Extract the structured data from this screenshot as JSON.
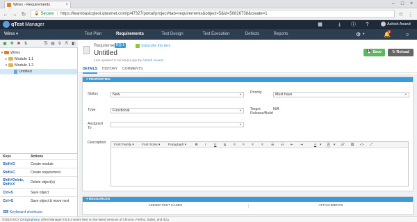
{
  "browser": {
    "tab_title": "Wires - Requirements",
    "url_secure_label": "Secure",
    "url": "https://learnbasicqtest.qtestnet.com/p/47327/portal/project#tab=requirements&object=5&id=50826738&create=1"
  },
  "app": {
    "logo_text": "qTest",
    "product": "Manager",
    "user_name": "Ashish Anand",
    "notif_count": "1",
    "colors": {
      "header": "#1e2a3a",
      "nav": "#2c3e50",
      "accent": "#3b9ad9",
      "save": "#5cb85c"
    }
  },
  "nav": {
    "project": "Wires",
    "tabs": [
      {
        "label": "Test Plan"
      },
      {
        "label": "Requirements"
      },
      {
        "label": "Test Design"
      },
      {
        "label": "Test Execution"
      },
      {
        "label": "Defects"
      },
      {
        "label": "Reports"
      }
    ],
    "active_tab": "Requirements"
  },
  "tree": {
    "root": "Wires",
    "items": [
      {
        "label": "Module 1.1"
      },
      {
        "label": "Module 1.2"
      },
      {
        "label": "Untitled"
      }
    ]
  },
  "shortcuts": {
    "head_key": "Keys",
    "head_action": "Actions",
    "rows": [
      {
        "key": "Shift+D",
        "action": "Create module"
      },
      {
        "key": "Shift+C",
        "action": "Create requirement"
      },
      {
        "key": "Shift+Delete, Shift+X",
        "action": "Delete object(s)"
      },
      {
        "key": "Ctrl+S",
        "action": "Save object"
      },
      {
        "key": "Ctrl+G",
        "action": "Save object & move next"
      }
    ],
    "link": "Keyboard shortcuts"
  },
  "requirement": {
    "type_label": "Requirement",
    "id": "RQ-1",
    "subscribe": "Subscribe this item",
    "title": "Untitled",
    "meta_prefix": "Last updated 6 minute(s) ago by",
    "meta_author": "Ashish Anand",
    "save_label": "Save",
    "reload_label": "Reload",
    "subtabs": [
      "DETAILS",
      "HISTORY",
      "COMMENTS"
    ]
  },
  "properties": {
    "header": "PROPERTIES",
    "status_label": "Status",
    "status_value": "New",
    "priority_label": "Priority",
    "priority_value": "Must have",
    "type_label": "Type",
    "type_value": "Functional",
    "target_label": "Target Release/Build",
    "target_value": "N/A",
    "assigned_label": "Assigned To",
    "assigned_value": "",
    "description_label": "Description",
    "editor": {
      "font_family": "Font Family",
      "font_sizes": "Font Sizes",
      "paragraph": "Paragraph",
      "bold": "B",
      "italic": "I",
      "underline": "U",
      "strike": "S"
    }
  },
  "resources": {
    "header": "RESOURCES",
    "col1": "LINKED TEST CASES",
    "col2": "ATTACHMENTS"
  },
  "footer": {
    "copyright": "2010-2017 ",
    "company": "QASymphony",
    "note": ". qTest Manager 8.5.5.2 works best on the latest versions of Chrome, Firefox, Safari, and IE11."
  }
}
